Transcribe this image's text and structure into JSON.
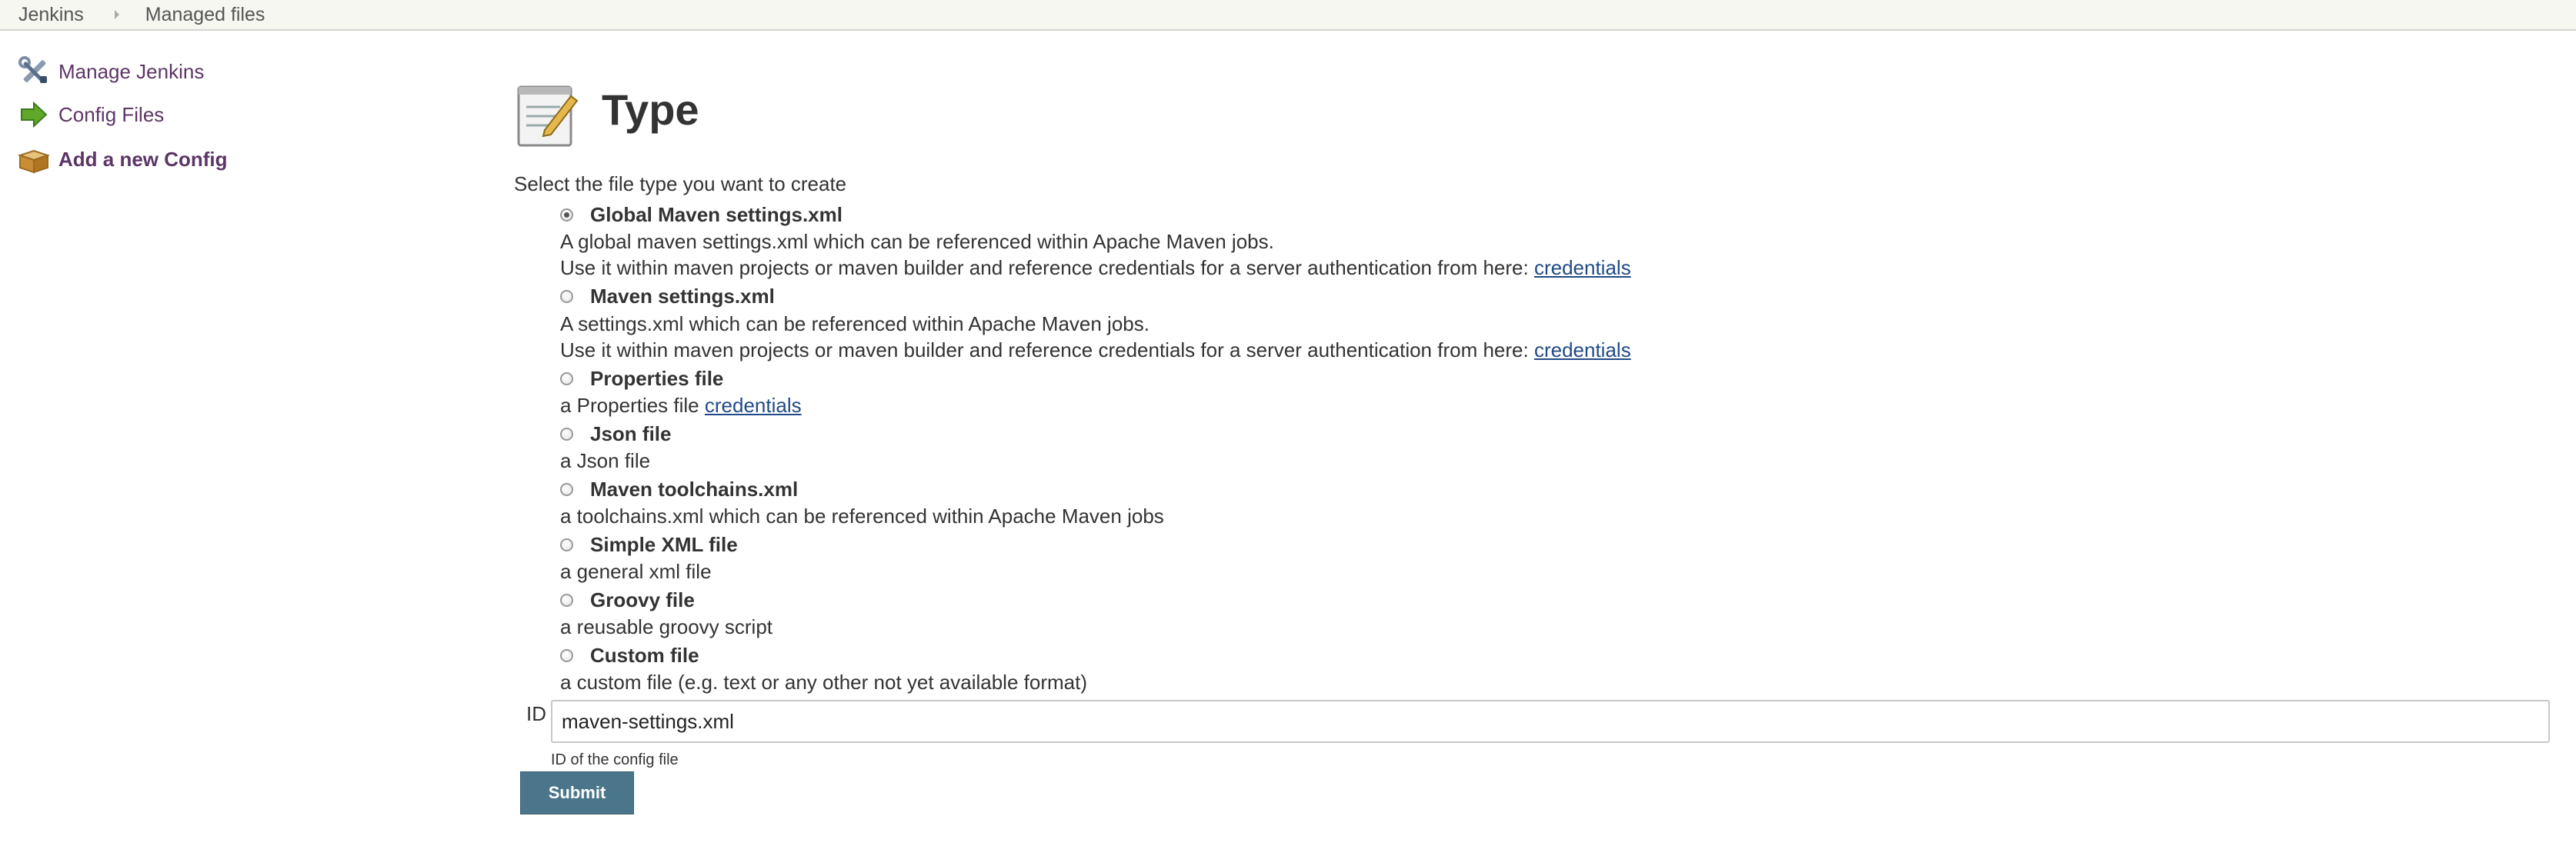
{
  "breadcrumb": {
    "root": "Jenkins",
    "current": "Managed files"
  },
  "sidebar": {
    "items": [
      {
        "label": "Manage Jenkins",
        "icon": "wrench-screwdriver-icon"
      },
      {
        "label": "Config Files",
        "icon": "green-arrow-icon"
      },
      {
        "label": "Add a new Config",
        "icon": "box-icon"
      }
    ]
  },
  "main": {
    "title": "Type",
    "title_icon": "notepad-icon",
    "prompt": "Select the file type you want to create",
    "selected_type": "Global Maven settings.xml",
    "options": [
      {
        "label": "Global Maven settings.xml",
        "line1": "A global maven settings.xml which can be referenced within Apache Maven jobs.",
        "line2_text": "Use it within maven projects or maven builder and reference credentials for a server authentication from here: ",
        "line2_link": "credentials"
      },
      {
        "label": "Maven settings.xml",
        "line1": "A settings.xml which can be referenced within Apache Maven jobs.",
        "line2_text": "Use it within maven projects or maven builder and reference credentials for a server authentication from here: ",
        "line2_link": "credentials"
      },
      {
        "label": "Properties file",
        "line1_text": "a Properties file ",
        "line1_link": "credentials"
      },
      {
        "label": "Json file",
        "line1": "a Json file"
      },
      {
        "label": "Maven toolchains.xml",
        "line1": "a toolchains.xml which can be referenced within Apache Maven jobs"
      },
      {
        "label": "Simple XML file",
        "line1": "a general xml file"
      },
      {
        "label": "Groovy file",
        "line1": "a reusable groovy script"
      },
      {
        "label": "Custom file",
        "line1": "a custom file (e.g. text or any other not yet available format)"
      }
    ],
    "id_field": {
      "label": "ID",
      "value": "maven-settings.xml",
      "help": "ID of the config file"
    },
    "submit_label": "Submit"
  },
  "colors": {
    "link": "#204a87",
    "sidebar_link": "#5c3566",
    "button": "#4b758b"
  }
}
